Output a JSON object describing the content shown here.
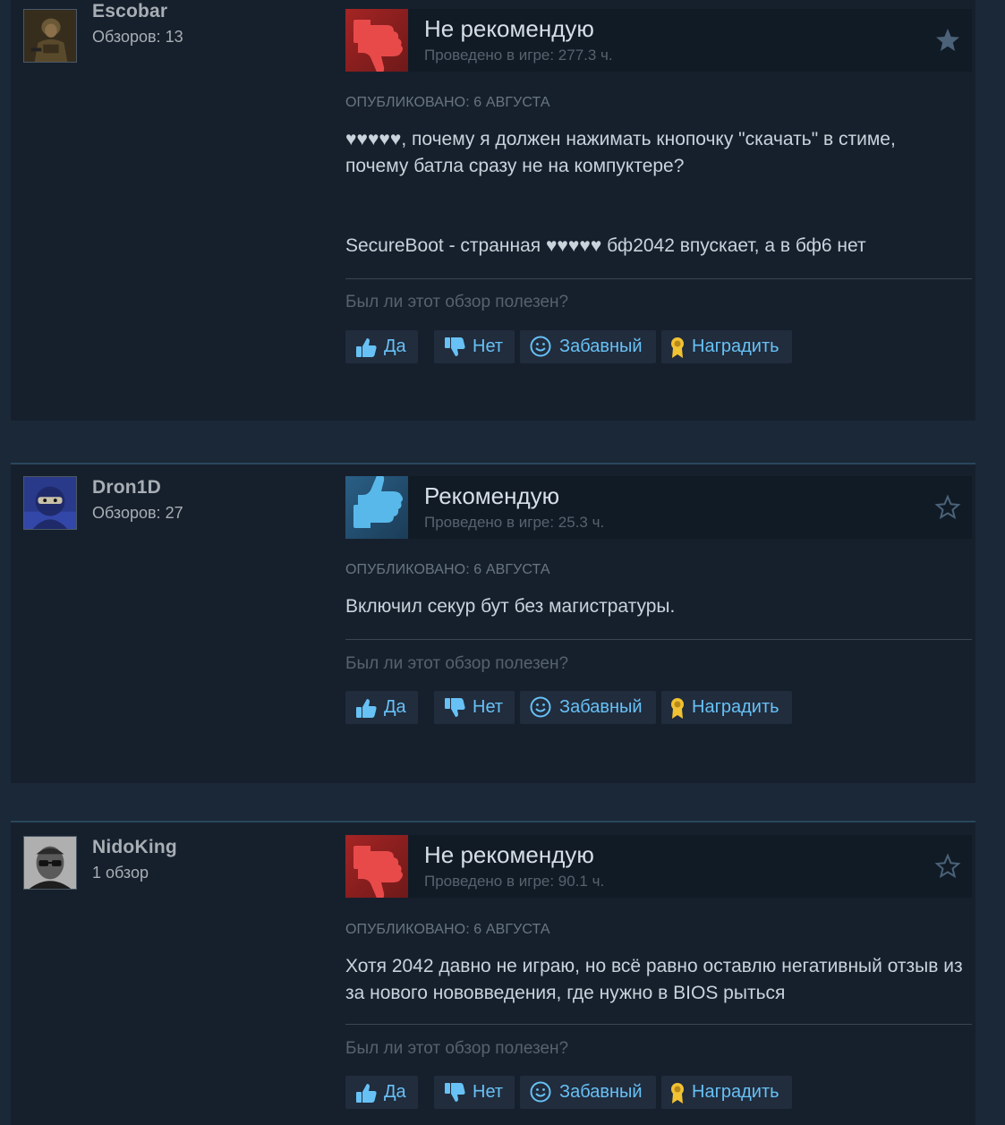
{
  "colors": {
    "page_bg": "#1b2838",
    "card_bg": "#16202d",
    "negative": "#a52424",
    "positive": "#2a5f86",
    "link": "#67c1f5",
    "award": "#f1c232"
  },
  "reviews": [
    {
      "user": {
        "name": "Escobar",
        "count": "Обзоров: 13",
        "avatar_icon": "soldier-avatar"
      },
      "verdict": {
        "label": "Не рекомендую",
        "hours": "Проведено в игре: 277.3 ч.",
        "type": "negative",
        "icon": "thumbs-down-icon",
        "starred": true
      },
      "posted": "ОПУБЛИКОВАНО: 6 АВГУСТА",
      "body": [
        "♥♥♥♥♥, почему я должен нажимать кнопочку \"скачать\" в стиме, почему батла сразу не на компуктере?",
        "SecureBoot - странная ♥♥♥♥♥ бф2042 впускает, а в бф6 нет"
      ],
      "helpful": "Был ли этот обзор полезен?",
      "buttons": {
        "yes": "Да",
        "no": "Нет",
        "funny": "Забавный",
        "award": "Наградить"
      }
    },
    {
      "user": {
        "name": "Dron1D",
        "count": "Обзоров: 27",
        "avatar_icon": "ninja-avatar"
      },
      "verdict": {
        "label": "Рекомендую",
        "hours": "Проведено в игре: 25.3 ч.",
        "type": "positive",
        "icon": "thumbs-up-icon",
        "starred": false
      },
      "posted": "ОПУБЛИКОВАНО: 6 АВГУСТА",
      "body": [
        "Включил секур бут без магистратуры."
      ],
      "helpful": "Был ли этот обзор полезен?",
      "buttons": {
        "yes": "Да",
        "no": "Нет",
        "funny": "Забавный",
        "award": "Наградить"
      }
    },
    {
      "user": {
        "name": "NidoKing",
        "count": "1 обзор",
        "avatar_icon": "man-in-glasses-avatar"
      },
      "verdict": {
        "label": "Не рекомендую",
        "hours": "Проведено в игре: 90.1 ч.",
        "type": "negative",
        "icon": "thumbs-down-icon",
        "starred": false
      },
      "posted": "ОПУБЛИКОВАНО: 6 АВГУСТА",
      "body": [
        "Хотя 2042 давно не играю, но всё равно оставлю негативный отзыв из за нового нововведения, где нужно в BIOS рыться"
      ],
      "helpful": "Был ли этот обзор полезен?",
      "buttons": {
        "yes": "Да",
        "no": "Нет",
        "funny": "Забавный",
        "award": "Наградить"
      }
    }
  ]
}
